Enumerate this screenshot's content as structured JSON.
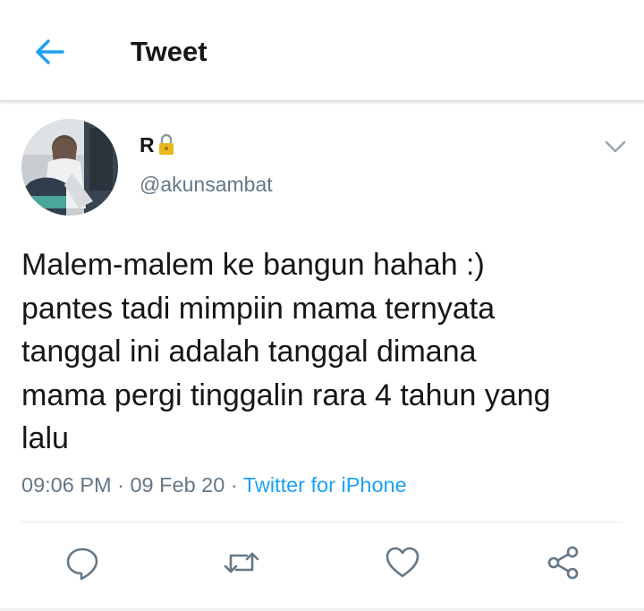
{
  "header": {
    "title": "Tweet",
    "back_icon": "arrow-left-icon",
    "accent_color": "#1da1f2"
  },
  "tweet": {
    "author": {
      "display_name": "R",
      "handle": "@akunsambat",
      "protected_icon": "lock-icon"
    },
    "text_lines": [
      "Malem-malem ke bangun hahah :)",
      "pantes tadi mimpiin mama ternyata",
      "tanggal ini adalah tanggal dimana",
      "mama pergi tinggalin rara 4 tahun yang",
      "lalu"
    ],
    "time": "09:06 PM",
    "separator": "·",
    "date": "09 Feb 20",
    "source": "Twitter for iPhone",
    "more_icon": "chevron-down-icon"
  },
  "actions": [
    {
      "name": "reply",
      "icon": "reply-bubble-icon"
    },
    {
      "name": "retweet",
      "icon": "retweet-icon"
    },
    {
      "name": "like",
      "icon": "heart-icon"
    },
    {
      "name": "share",
      "icon": "share-icon"
    }
  ]
}
